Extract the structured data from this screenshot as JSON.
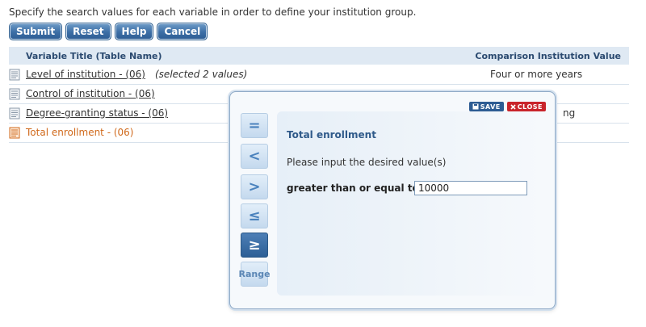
{
  "instruction": "Specify the search values for each variable in order to define your institution group.",
  "buttons": {
    "submit": "Submit",
    "reset": "Reset",
    "help": "Help",
    "cancel": "Cancel"
  },
  "table": {
    "header": {
      "variable_title": "Variable Title (Table Name)",
      "comparison_value": "Comparison Institution Value"
    },
    "rows": [
      {
        "title": "Level of institution  - (06)",
        "note": "(selected 2 values)",
        "value": "Four or more years"
      },
      {
        "title": "Control of institution  - (06)",
        "note": "",
        "value": ""
      },
      {
        "title": "Degree-granting status  - (06)",
        "note": "",
        "value": "ng"
      },
      {
        "title": "Total enrollment  - (06)",
        "note": "",
        "value": ""
      }
    ]
  },
  "modal": {
    "save_label": "SAVE",
    "close_label": "CLOSE",
    "title": "Total enrollment",
    "prompt": "Please input the desired value(s)",
    "operator_label": "greater than or equal to",
    "input_value": "10000",
    "operators": {
      "eq": "=",
      "lt": "<",
      "gt": ">",
      "le": "≤",
      "ge": "≥",
      "range": "Range"
    },
    "selected_operator": "ge"
  },
  "colors": {
    "button_blue": "#3c6ea5",
    "active_row_orange": "#d0691b",
    "close_red": "#c9242b",
    "header_bg": "#dfe9f3"
  }
}
